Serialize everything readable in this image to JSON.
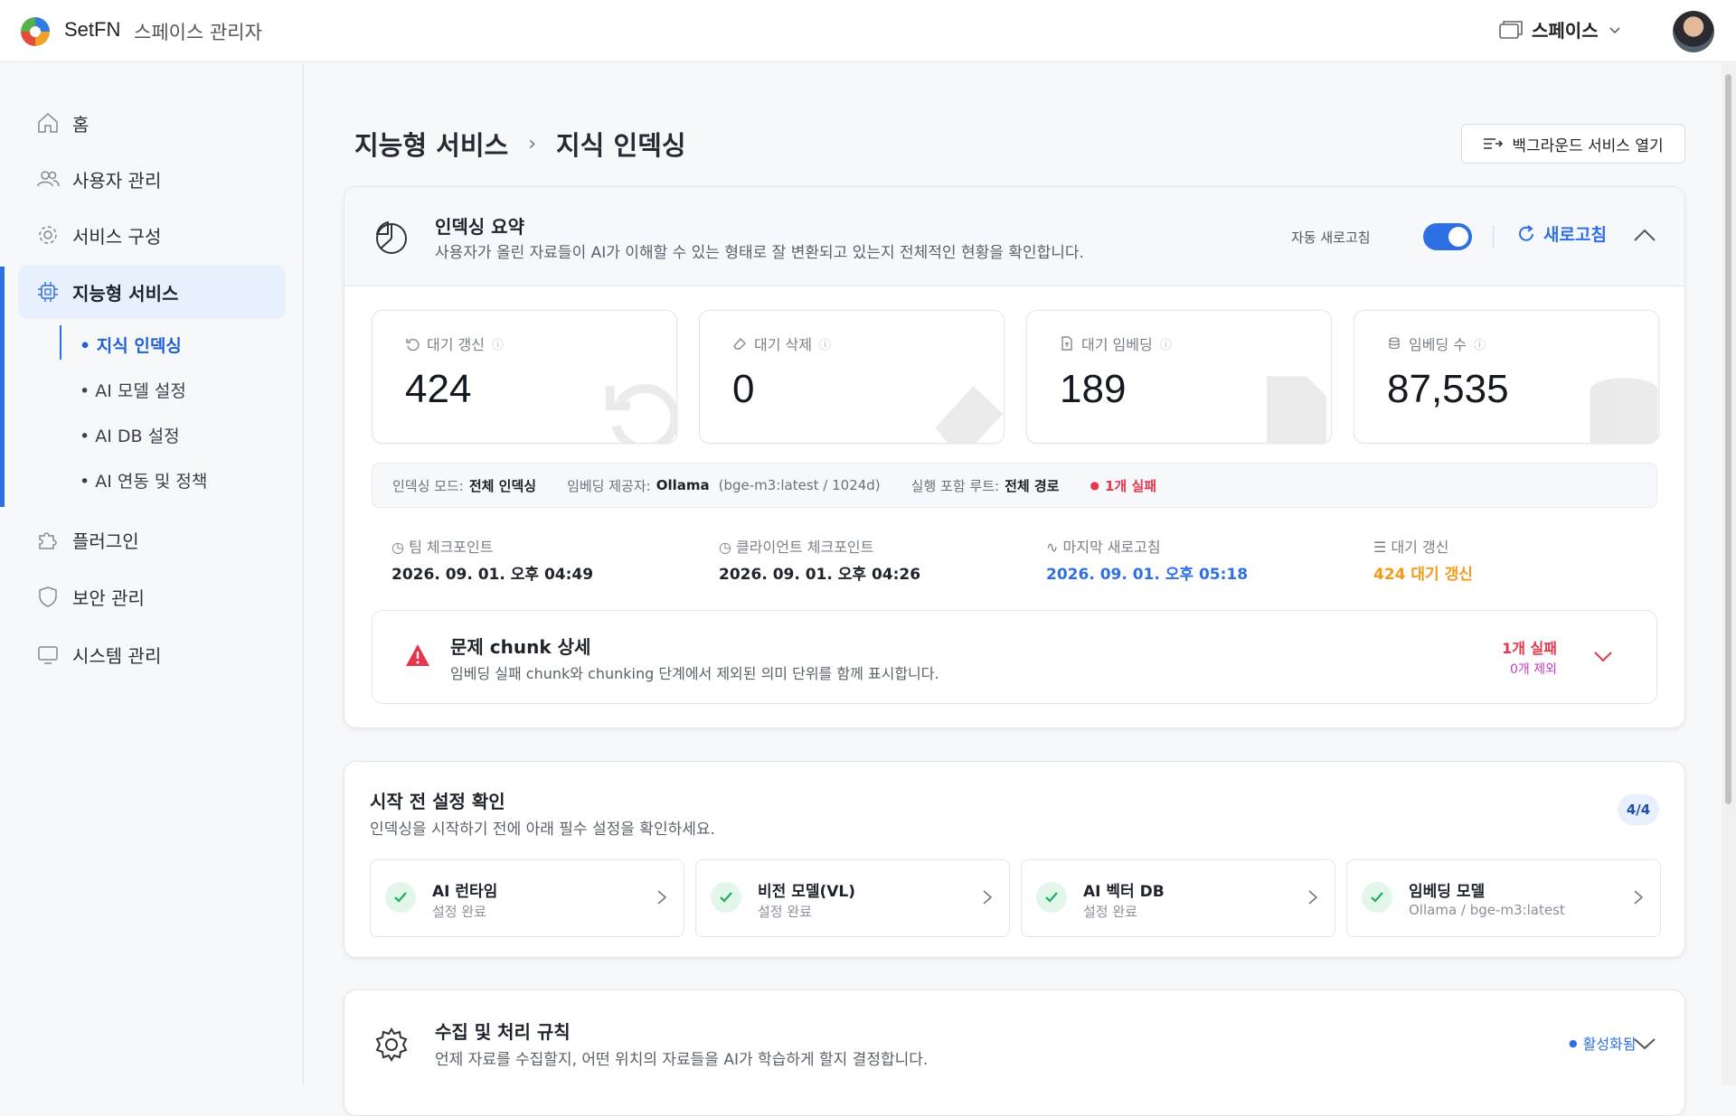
{
  "app": {
    "brand": "SetFN",
    "subtitle": "스페이스 관리자",
    "space_label": "스페이스"
  },
  "sidebar": {
    "items": [
      {
        "label": "홈",
        "icon": "home-icon"
      },
      {
        "label": "사용자 관리",
        "icon": "users-icon"
      },
      {
        "label": "서비스 구성",
        "icon": "gear-icon"
      },
      {
        "label": "지능형 서비스",
        "icon": "chip-icon"
      },
      {
        "label": "플러그인",
        "icon": "puzzle-icon"
      },
      {
        "label": "보안 관리",
        "icon": "shield-icon"
      },
      {
        "label": "시스템 관리",
        "icon": "monitor-icon"
      }
    ],
    "subitems": [
      "지식 인덱싱",
      "AI 모델 설정",
      "AI DB 설정",
      "AI 연동 및 정책"
    ]
  },
  "breadcrumb": {
    "parent": "지능형 서비스",
    "current": "지식 인덱싱"
  },
  "bg_button": "백그라운드 서비스 열기",
  "summary": {
    "title": "인덱싱 요약",
    "desc": "사용자가 올린 자료들이 AI가 이해할 수 있는 형태로 잘 변환되고 있는지 전체적인 현황을 확인합니다.",
    "auto_refresh_label": "자동 새로고침",
    "auto_refresh_on": true,
    "refresh_label": "새로고침",
    "stats": [
      {
        "label": "대기 갱신",
        "value": "424"
      },
      {
        "label": "대기 삭제",
        "value": "0"
      },
      {
        "label": "대기 임베딩",
        "value": "189"
      },
      {
        "label": "임베딩 수",
        "value": "87,535"
      }
    ],
    "info": {
      "mode_label": "인덱싱 모드:",
      "mode_value": "전체 인덱싱",
      "provider_label": "임베딩 제공자:",
      "provider_value": "Ollama",
      "provider_detail": "(bge-m3:latest / 1024d)",
      "root_label": "실행 포함 루트:",
      "root_value": "전체 경로",
      "fail": "1개 실패"
    },
    "checkpoints": [
      {
        "label": "팀 체크포인트",
        "value": "2026. 09. 01. 오후 04:49"
      },
      {
        "label": "클라이언트 체크포인트",
        "value": "2026. 09. 01. 오후 04:26"
      },
      {
        "label": "마지막 새로고침",
        "value": "2026. 09. 01. 오후 05:18"
      },
      {
        "label": "대기 갱신",
        "value": "424 대기 갱신"
      }
    ],
    "chunk": {
      "title": "문제 chunk 상세",
      "desc": "임베딩 실패 chunk와 chunking 단계에서 제외된 의미 단위를 함께 표시합니다.",
      "fail": "1개 실패",
      "excluded": "0개 제외"
    }
  },
  "precheck": {
    "title": "시작 전 설정 확인",
    "desc": "인덱싱을 시작하기 전에 아래 필수 설정을 확인하세요.",
    "badge": "4/4",
    "items": [
      {
        "title": "AI 런타임",
        "status": "설정 완료"
      },
      {
        "title": "비전 모델(VL)",
        "status": "설정 완료"
      },
      {
        "title": "AI 벡터 DB",
        "status": "설정 완료"
      },
      {
        "title": "임베딩 모델",
        "status": "Ollama / bge-m3:latest"
      }
    ]
  },
  "rules": {
    "title": "수집 및 처리 규칙",
    "desc": "언제 자료를 수집할지, 어떤 위치의 자료들을 AI가 학습하게 할지 결정합니다.",
    "status": "활성화됨"
  },
  "colors": {
    "accent": "#2f6fe4",
    "danger": "#e5364d",
    "warning": "#f39a1b",
    "success": "#1fae5b",
    "magenta": "#c63bc6"
  }
}
